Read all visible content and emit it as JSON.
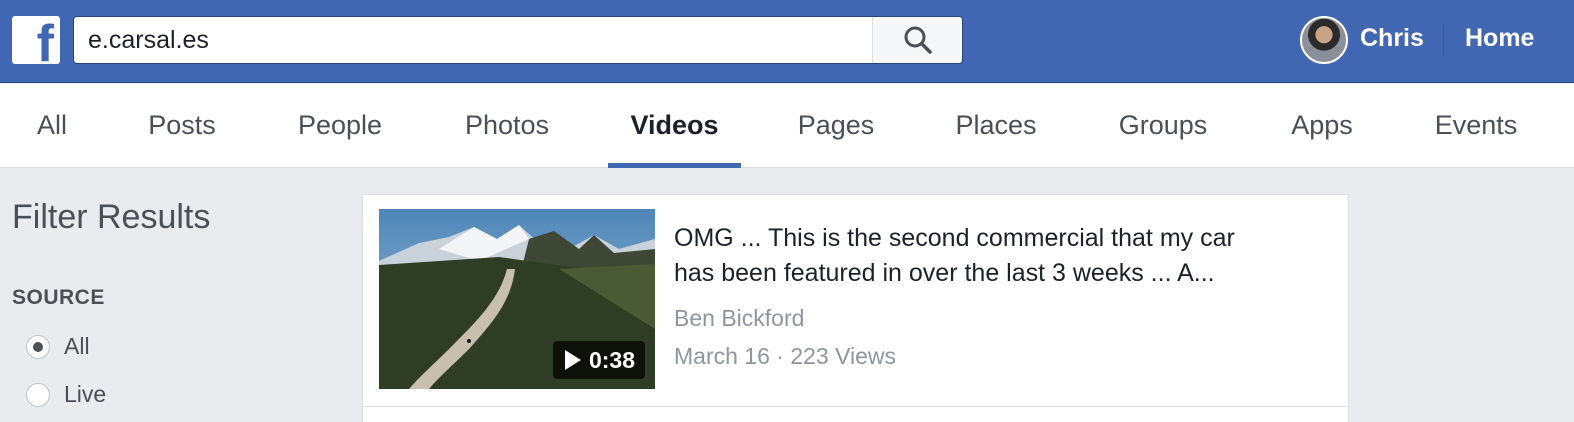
{
  "header": {
    "logo_letter": "f",
    "search_value": "e.carsal.es",
    "user_name": "Chris",
    "home_label": "Home"
  },
  "tabs": [
    {
      "label": "All"
    },
    {
      "label": "Posts"
    },
    {
      "label": "People"
    },
    {
      "label": "Photos"
    },
    {
      "label": "Videos",
      "active": true
    },
    {
      "label": "Pages"
    },
    {
      "label": "Places"
    },
    {
      "label": "Groups"
    },
    {
      "label": "Apps"
    },
    {
      "label": "Events"
    }
  ],
  "filter": {
    "title": "Filter Results",
    "source_label": "SOURCE",
    "options": [
      {
        "label": "All",
        "selected": true
      },
      {
        "label": "Live",
        "selected": false
      }
    ]
  },
  "result": {
    "title_line1": "OMG ... This is the second commercial that my car",
    "title_line2": "has been featured in over the last 3 weeks ... A...",
    "author": "Ben Bickford",
    "meta": "March 16 · 223 Views",
    "duration": "0:38"
  },
  "colors": {
    "brand_blue": "#4267b2",
    "page_bg": "#e9ebee",
    "muted_text": "#90949c"
  }
}
